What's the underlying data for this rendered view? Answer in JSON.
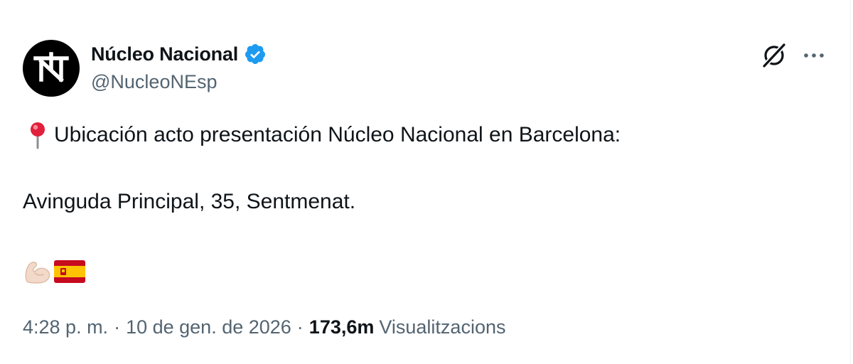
{
  "tweet": {
    "author": {
      "display_name": "Núcleo Nacional",
      "handle": "@NucleoNEsp",
      "verified_color": "#1d9bf0",
      "avatar_icon": "nn-monogram-logo"
    },
    "actions": {
      "grok_icon": "grok-icon",
      "more_icon": "more-options-icon"
    },
    "text": {
      "line1_emoji": "round-pushpin-emoji",
      "line1": "Ubicación acto presentación Núcleo Nacional en Barcelona:",
      "line2": "Avinguda Principal, 35, Sentmenat.",
      "emojis": [
        "flexed-biceps-emoji",
        "spain-flag-emoji"
      ]
    },
    "meta": {
      "time": "4:28 p. m.",
      "separator": "·",
      "date": "10 de gen. de 2026",
      "views_count": "173,6m",
      "views_label": "Visualitzacions"
    }
  },
  "colors": {
    "text_primary": "#0f1419",
    "text_secondary": "#536471",
    "accent": "#1d9bf0"
  }
}
